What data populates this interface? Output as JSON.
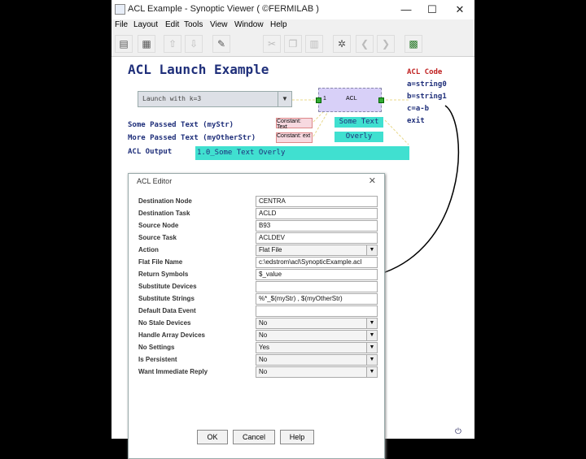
{
  "window": {
    "title": "ACL Example - Synoptic Viewer ( ©FERMILAB )"
  },
  "window_controls": {
    "minimize": "—",
    "maximize": "☐",
    "close": "✕"
  },
  "menu": [
    "File",
    "Layout",
    "Edit",
    "Tools",
    "View",
    "Window",
    "Help"
  ],
  "canvas": {
    "heading": "ACL Launch Example",
    "launch_combo": "Launch with  k=3",
    "acl_node_in": "1",
    "acl_node_label": "ACL",
    "some_passed_label": "Some Passed Text (myStr)",
    "more_passed_label": "More Passed Text (myOtherStr)",
    "acl_output_label": "ACL Output",
    "constant_text_1": "Constant: Text",
    "constant_text_2": "Constant:  ext",
    "some_text_box": "Some Text",
    "overly_box": "Overly",
    "output_value": "1.0_Some Text Overly",
    "acl_code": {
      "title": "ACL Code",
      "lines": [
        "a=string0",
        "b=string1",
        "c=a-b",
        "exit"
      ]
    }
  },
  "dialog": {
    "title": "ACL Editor",
    "rows": [
      {
        "label": "Destination Node",
        "value": "CENTRA",
        "type": "text"
      },
      {
        "label": "Destination Task",
        "value": "ACLD",
        "type": "text"
      },
      {
        "label": "Source Node",
        "value": "B93",
        "type": "text"
      },
      {
        "label": "Source Task",
        "value": "ACLDEV",
        "type": "text"
      },
      {
        "label": "Action",
        "value": "Flat File",
        "type": "select"
      },
      {
        "label": "Flat File Name",
        "value": "c:\\edstrom\\acl\\SynopticExample.acl",
        "type": "text"
      },
      {
        "label": "Return Symbols",
        "value": "$_value",
        "type": "text"
      },
      {
        "label": "Substitute Devices",
        "value": "",
        "type": "text"
      },
      {
        "label": "Substitute Strings",
        "value": "%*_$(myStr) , $(myOtherStr)",
        "type": "text"
      },
      {
        "label": "Default Data Event",
        "value": "",
        "type": "text"
      },
      {
        "label": "No Stale Devices",
        "value": "No",
        "type": "select"
      },
      {
        "label": "Handle Array Devices",
        "value": "No",
        "type": "select"
      },
      {
        "label": "No Settings",
        "value": "Yes",
        "type": "select"
      },
      {
        "label": "Is Persistent",
        "value": "No",
        "type": "select"
      },
      {
        "label": "Want Immediate Reply",
        "value": "No",
        "type": "select"
      }
    ],
    "buttons": {
      "ok": "OK",
      "cancel": "Cancel",
      "help": "Help"
    }
  },
  "colors": {
    "accent_cyan": "#40e0d0",
    "heading_blue": "#1f2f7a",
    "code_red": "#c02020",
    "node_purple": "#d8d0f8"
  },
  "icons": [
    "open-icon",
    "layout-icon",
    "upload-icon",
    "download-icon",
    "edit-icon",
    "cut-icon",
    "copy-icon",
    "paste-icon",
    "network-icon",
    "back-icon",
    "forward-icon",
    "grid-icon"
  ]
}
